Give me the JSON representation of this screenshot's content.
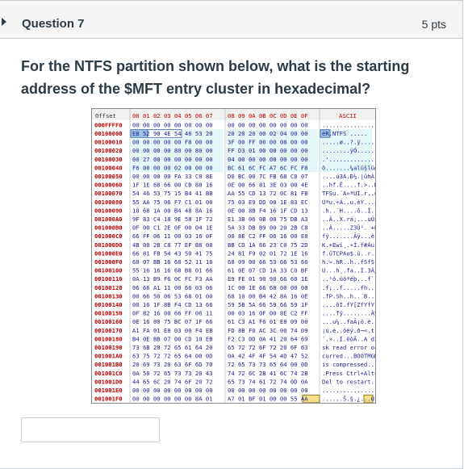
{
  "question": {
    "title": "Question 7",
    "points": "5 pts",
    "text": "For the NTFS partition shown below, what is the starting address of the $MFT entry cluster in hexadecimal?"
  },
  "answer": {
    "value": ""
  },
  "hexdump": {
    "offset_header": "Offset",
    "col_headers_a": "00 01 02 03 04 05 06 07",
    "col_headers_b": "08 09 0A 0B 0C 0D 0E 0F",
    "ascii_header": "ASCII",
    "rows": [
      {
        "offset": "000FFFF0",
        "a": "00 00 00 00 00 00 00 00",
        "b": "00 00 00 00 00 00 00 00",
        "ascii": "................"
      },
      {
        "offset": "00100000",
        "a": "EB 52 90 4E 54 46 53 20",
        "b": "20 20 20 00 02 04 00 00",
        "ascii": "ëR.NTFS    ....."
      },
      {
        "offset": "00100010",
        "a": "00 00 00 00 00 F8 00 00",
        "b": "3F 00 FF 00 00 08 00 00",
        "ascii": ".....ø..?.ÿ....."
      },
      {
        "offset": "00100020",
        "a": "00 00 00 00 80 00 80 00",
        "b": "FF D3 01 00 00 00 00 00",
        "ascii": "........ÿÓ......"
      },
      {
        "offset": "00100030",
        "a": "00 27 00 00 00 00 00 00",
        "b": "04 00 00 00 00 00 00 00",
        "ascii": ".'.............."
      },
      {
        "offset": "00100040",
        "a": "F6 00 00 00 02 00 00 00",
        "b": "BC 61 6C FC A7 6C FC F8",
        "ascii": "ö.......¼alü§lüø"
      },
      {
        "offset": "00100050",
        "a": "00 00 00 00 FA 33 C0 8E",
        "b": "D0 BC 00 7C FB 68 C0 07",
        "ascii": "....ú3À.Ð¼.|ûhÀ."
      },
      {
        "offset": "00100060",
        "a": "1F 1E 68 66 00 CB 88 16",
        "b": "0E 00 66 81 3E 03 00 4E",
        "ascii": "..hf.Ë....f.>..N"
      },
      {
        "offset": "00100070",
        "a": "54 46 53 75 15 B4 41 BB",
        "b": "AA 55 CD 13 72 0C 81 FB",
        "ascii": "TFSu.´A»ªUÍ.r..û"
      },
      {
        "offset": "00100080",
        "a": "55 AA 75 06 F7 C1 01 00",
        "b": "75 03 E9 DD 00 1E 83 EC",
        "ascii": "Uªu.÷Á..u.éÝ...ì"
      },
      {
        "offset": "00100090",
        "a": "18 68 1A 00 B4 48 8A 16",
        "b": "0E 00 8B F4 16 1F CD 13",
        "ascii": ".h..´H....ô..Í."
      },
      {
        "offset": "001000A0",
        "a": "9F 83 C4 18 9E 58 1F 72",
        "b": "E1 3B 06 0B 00 75 DB A3",
        "ascii": "..Ä..X.rá;...uÛ£"
      },
      {
        "offset": "001000B0",
        "a": "0F 00 C1 2E 0F 00 04 1E",
        "b": "5A 33 DB B9 00 20 2B C8",
        "ascii": "..Á.....Z3Û¹. +È"
      },
      {
        "offset": "001000C0",
        "a": "66 FF 06 11 00 03 16 0F",
        "b": "00 8E C2 FF 06 16 00 E8",
        "ascii": "fÿ.......Âÿ...è"
      },
      {
        "offset": "001000D0",
        "a": "4B 00 2B C8 77 EF B8 00",
        "b": "BB CD 1A 66 23 C0 75 2D",
        "ascii": "K.+Èwï¸.»Í.f#Àu-"
      },
      {
        "offset": "001000E0",
        "a": "66 81 FB 54 43 50 41 75",
        "b": "24 81 F9 02 01 72 1E 16",
        "ascii": "f.ûTCPAu$.ù..r.."
      },
      {
        "offset": "001000F0",
        "a": "68 07 BB 16 68 52 11 16",
        "b": "68 09 00 66 53 66 53 66",
        "ascii": "h.».hR..h..fSfSf"
      },
      {
        "offset": "00100100",
        "a": "55 16 16 16 68 B8 01 66",
        "b": "61 0E 07 CD 1A 33 C0 BF",
        "ascii": "U...h¸.fa..Í.3À¿"
      },
      {
        "offset": "00100110",
        "a": "0A 13 B9 F6 0C FC F3 AA",
        "b": "E9 FE 01 90 90 66 60 1E",
        "ascii": "..¹ö.üóªéþ...f`."
      },
      {
        "offset": "00100120",
        "a": "06 66 A1 11 00 66 03 06",
        "b": "1C 00 1E 66 68 00 00 00",
        "ascii": ".f¡..f.....fh..."
      },
      {
        "offset": "00100130",
        "a": "00 66 50 06 53 68 01 00",
        "b": "68 10 00 B4 42 8A 16 0E",
        "ascii": ".fP.Sh..h..´B..."
      },
      {
        "offset": "00100140",
        "a": "00 16 1F 8B F4 CD 13 66",
        "b": "59 5B 5A 66 59 66 59 1F",
        "ascii": "....ôÍ.fY[ZfYfY."
      },
      {
        "offset": "00100150",
        "a": "0F 82 16 00 66 FF 06 11",
        "b": "00 03 16 0F 00 8E C2 FF",
        "ascii": "....fÿ........Âÿ"
      },
      {
        "offset": "00100160",
        "a": "0E 16 00 75 BC 07 1F 66",
        "b": "61 C3 A1 F6 01 E8 09 00",
        "ascii": "...u¼..faÃ¡ö.è.."
      },
      {
        "offset": "00100170",
        "a": "A1 FA 01 E8 03 00 F4 EB",
        "b": "FD 8B F0 AC 3C 00 74 09",
        "ascii": "¡ú.è..ôëý.ð¬<.t."
      },
      {
        "offset": "00100180",
        "a": "B4 0E BB 07 00 CD 10 EB",
        "b": "F2 C3 0D 0A 41 20 64 69",
        "ascii": "´.»..Í.ëòÃ..A di"
      },
      {
        "offset": "00100190",
        "a": "73 6B 20 72 65 61 64 20",
        "b": "65 72 72 6F 72 20 6F 63",
        "ascii": "sk read error oc"
      },
      {
        "offset": "001001A0",
        "a": "63 75 72 72 65 64 00 0D",
        "b": "0A 42 4F 4F 54 4D 47 52",
        "ascii": "curred...BOOTMGR"
      },
      {
        "offset": "001001B0",
        "a": "20 69 73 20 63 6F 6D 70",
        "b": "72 65 73 73 65 64 00 0D",
        "ascii": " is compressed.."
      },
      {
        "offset": "001001C0",
        "a": "0A 50 72 65 73 73 20 43",
        "b": "74 72 6C 2B 41 6C 74 2B",
        "ascii": ".Press Ctrl+Alt+"
      },
      {
        "offset": "001001D0",
        "a": "44 65 6C 20 74 6F 20 72",
        "b": "65 73 74 61 72 74 0D 0A",
        "ascii": "Del to restart.."
      },
      {
        "offset": "001001E0",
        "a": "00 00 00 00 00 00 00 00",
        "b": "00 00 00 00 00 00 00 00",
        "ascii": "................"
      },
      {
        "offset": "001001F0",
        "a": "00 00 00 00 00 00 8A 01",
        "b": "A7 01 BF 01 00 00 55 AA",
        "ascii": "......Š.§.¿...Uª"
      }
    ]
  }
}
